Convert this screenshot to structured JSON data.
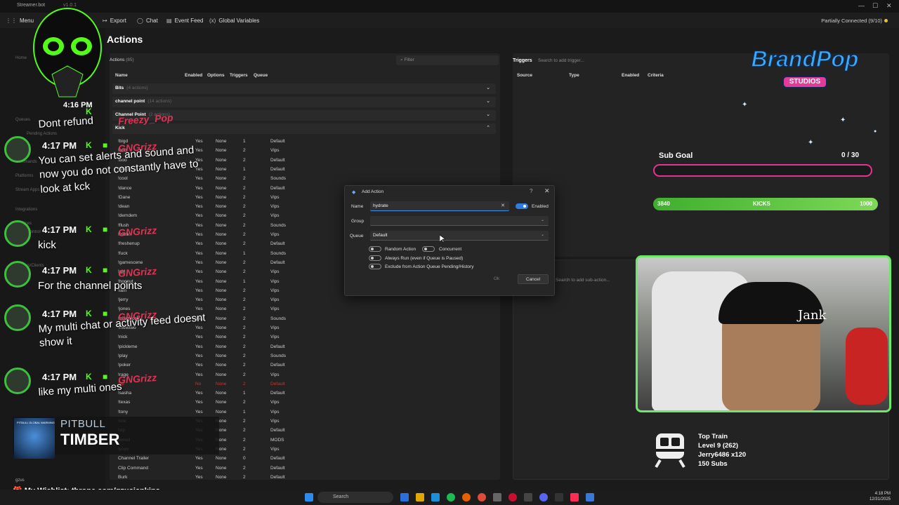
{
  "window": {
    "title": "Streamer.bot",
    "version": "v1.0.1",
    "controls": [
      "—",
      "☐",
      "✕"
    ]
  },
  "menubar": {
    "menu": "Menu",
    "export": "Export",
    "chat": "Chat",
    "event_feed": "Event Feed",
    "global_variables": "Global Variables",
    "connection_status": "Partially Connected (9/10)"
  },
  "sidebar": {
    "items": [
      "Home",
      "Queues",
      "Pending Actions",
      "Commands",
      "Platforms",
      "Stream Apps",
      "Integrations",
      "Services",
      "Voice Control",
      "Servers/Clients"
    ],
    "user": "gzus"
  },
  "page": {
    "title": "Actions"
  },
  "actions": {
    "title": "Actions",
    "count": "(85)",
    "filter_placeholder": "Filter",
    "columns": [
      "Name",
      "Enabled",
      "Options",
      "Triggers",
      "Queue"
    ],
    "groups": [
      {
        "name": "Bits",
        "count": "(4 actions)"
      },
      {
        "name": "channel point",
        "count": "(14 actions)"
      },
      {
        "name": "Channel Point",
        "count": "(2 actions)"
      },
      {
        "name": "Kick",
        "count": ""
      }
    ],
    "rows": [
      {
        "name": "!bigd",
        "enabled": "Yes",
        "options": "None",
        "triggers": "1",
        "queue": "Default"
      },
      {
        "name": "!bob",
        "enabled": "Yes",
        "options": "None",
        "triggers": "2",
        "queue": "Vips"
      },
      {
        "name": "!boo",
        "enabled": "Yes",
        "options": "None",
        "triggers": "2",
        "queue": "Default"
      },
      {
        "name": "!chuck",
        "enabled": "Yes",
        "options": "None",
        "triggers": "1",
        "queue": "Default"
      },
      {
        "name": "!cool",
        "enabled": "Yes",
        "options": "None",
        "triggers": "2",
        "queue": "Sounds"
      },
      {
        "name": "!dance",
        "enabled": "Yes",
        "options": "None",
        "triggers": "2",
        "queue": "Default"
      },
      {
        "name": "!Dane",
        "enabled": "Yes",
        "options": "None",
        "triggers": "2",
        "queue": "Vips"
      },
      {
        "name": "!dean",
        "enabled": "Yes",
        "options": "None",
        "triggers": "2",
        "queue": "Vips"
      },
      {
        "name": "!demdem",
        "enabled": "Yes",
        "options": "None",
        "triggers": "2",
        "queue": "Vips"
      },
      {
        "name": "!flush",
        "enabled": "Yes",
        "options": "None",
        "triggers": "2",
        "queue": "Sounds"
      },
      {
        "name": "!frank",
        "enabled": "Yes",
        "options": "None",
        "triggers": "2",
        "queue": "Vips"
      },
      {
        "name": "!freshenup",
        "enabled": "Yes",
        "options": "None",
        "triggers": "2",
        "queue": "Default"
      },
      {
        "name": "!fuck",
        "enabled": "Yes",
        "options": "None",
        "triggers": "1",
        "queue": "Sounds"
      },
      {
        "name": "!gamescene",
        "enabled": "Yes",
        "options": "None",
        "triggers": "2",
        "queue": "Default"
      },
      {
        "name": "!girl",
        "enabled": "Yes",
        "options": "None",
        "triggers": "2",
        "queue": "Vips"
      },
      {
        "name": "!hognut",
        "enabled": "Yes",
        "options": "None",
        "triggers": "1",
        "queue": "Vips"
      },
      {
        "name": "!iam",
        "enabled": "Yes",
        "options": "None",
        "triggers": "2",
        "queue": "Vips"
      },
      {
        "name": "!jerry",
        "enabled": "Yes",
        "options": "None",
        "triggers": "2",
        "queue": "Vips"
      },
      {
        "name": "!jones",
        "enabled": "Yes",
        "options": "None",
        "triggers": "2",
        "queue": "Vips"
      },
      {
        "name": "!marzbock",
        "enabled": "Yes",
        "options": "None",
        "triggers": "2",
        "queue": "Sounds"
      },
      {
        "name": "!mewtwo",
        "enabled": "Yes",
        "options": "None",
        "triggers": "2",
        "queue": "Vips"
      },
      {
        "name": "!nick",
        "enabled": "Yes",
        "options": "None",
        "triggers": "2",
        "queue": "Vips"
      },
      {
        "name": "!pickleme",
        "enabled": "Yes",
        "options": "None",
        "triggers": "2",
        "queue": "Default"
      },
      {
        "name": "!play",
        "enabled": "Yes",
        "options": "None",
        "triggers": "2",
        "queue": "Sounds"
      },
      {
        "name": "!poker",
        "enabled": "Yes",
        "options": "None",
        "triggers": "2",
        "queue": "Default"
      },
      {
        "name": "!rage",
        "enabled": "Yes",
        "options": "None",
        "triggers": "2",
        "queue": "Vips"
      },
      {
        "name": "!rip",
        "enabled": "No",
        "options": "None",
        "triggers": "2",
        "queue": "Default"
      },
      {
        "name": "!sasha",
        "enabled": "Yes",
        "options": "None",
        "triggers": "1",
        "queue": "Default"
      },
      {
        "name": "!texas",
        "enabled": "Yes",
        "options": "None",
        "triggers": "2",
        "queue": "Vips"
      },
      {
        "name": "!tony",
        "enabled": "Yes",
        "options": "None",
        "triggers": "1",
        "queue": "Vips"
      },
      {
        "name": "!unc",
        "enabled": "Yes",
        "options": "None",
        "triggers": "2",
        "queue": "Vips"
      },
      {
        "name": "!vip",
        "enabled": "Yes",
        "options": "None",
        "triggers": "2",
        "queue": "Default"
      },
      {
        "name": "!weed",
        "enabled": "Yes",
        "options": "None",
        "triggers": "2",
        "queue": "MODS"
      },
      {
        "name": "!yoyo",
        "enabled": "Yes",
        "options": "None",
        "triggers": "2",
        "queue": "Vips"
      },
      {
        "name": "Channel Trailer",
        "enabled": "Yes",
        "options": "None",
        "triggers": "0",
        "queue": "Default"
      },
      {
        "name": "Clip Command",
        "enabled": "Yes",
        "options": "None",
        "triggers": "2",
        "queue": "Default"
      },
      {
        "name": "Burk",
        "enabled": "Yes",
        "options": "None",
        "triggers": "2",
        "queue": "Default"
      }
    ]
  },
  "triggers": {
    "title": "Triggers",
    "search_placeholder": "Search to add trigger...",
    "columns": [
      "Source",
      "Type",
      "Enabled",
      "Criteria"
    ],
    "subactions_placeholder": "Search to add sub-action..."
  },
  "dialog": {
    "title": "Add Action",
    "help": "?",
    "close": "✕",
    "name_label": "Name",
    "name_value": "hydrate",
    "enabled_label": "Enabled",
    "group_label": "Group",
    "group_value": "",
    "queue_label": "Queue",
    "queue_value": "Default",
    "random_action": "Random Action",
    "concurrent": "Concurrent",
    "always_run": "Always Run (even if Queue is Paused)",
    "exclude": "Exclude from Action Queue Pending/History",
    "ok": "Ok",
    "cancel": "Cancel"
  },
  "overlay": {
    "brand_main": "BrandPop",
    "brand_sub": "STUDIOS",
    "subgoal_label": "Sub Goal",
    "subgoal_count": "0 / 30",
    "subgoal_progress": 0,
    "kicks_left": "3840",
    "kicks_label": "KICKS",
    "kicks_right": "1000",
    "cam_name": "Jank",
    "train_title": "Top Train",
    "train_level": "Level 9  (262)",
    "train_user": "Jerry6486 x120",
    "train_subs": "150 Subs",
    "music_artist": "PITBULL",
    "music_title": "TIMBER",
    "music_art_text": "PITBULL GLOBAL WARMING",
    "wishlist": "My Wishlist: throne.com/gzusjankins"
  },
  "chat": [
    {
      "time": "4:17 PM",
      "user": "Freezy_Pop",
      "msg": "Dont refund"
    },
    {
      "time": "4:17 PM",
      "user": "GNGrizz",
      "msg": "You can set alerts and sound and now you do not constantly have to look at kck"
    },
    {
      "time": "4:17 PM",
      "user": "GNGrizz",
      "msg": "kick"
    },
    {
      "time": "4:17 PM",
      "user": "GNGrizz",
      "msg": "For the channel points"
    },
    {
      "time": "4:17 PM",
      "user": "GNGrizz",
      "msg": "My multi chat or activity feed doesnt show it"
    },
    {
      "time": "4:17 PM",
      "user": "GNGrizz",
      "msg": "like my multi ones"
    }
  ],
  "chat_prev_time": "4:16 PM",
  "taskbar": {
    "search": "Search",
    "time": "4:18 PM",
    "date": "12/31/2025"
  },
  "colors": {
    "accent": "#2f7de1",
    "kick_green": "#53fc18",
    "subgoal_pink": "#e2358f",
    "webcam_border": "#6ee86b"
  }
}
